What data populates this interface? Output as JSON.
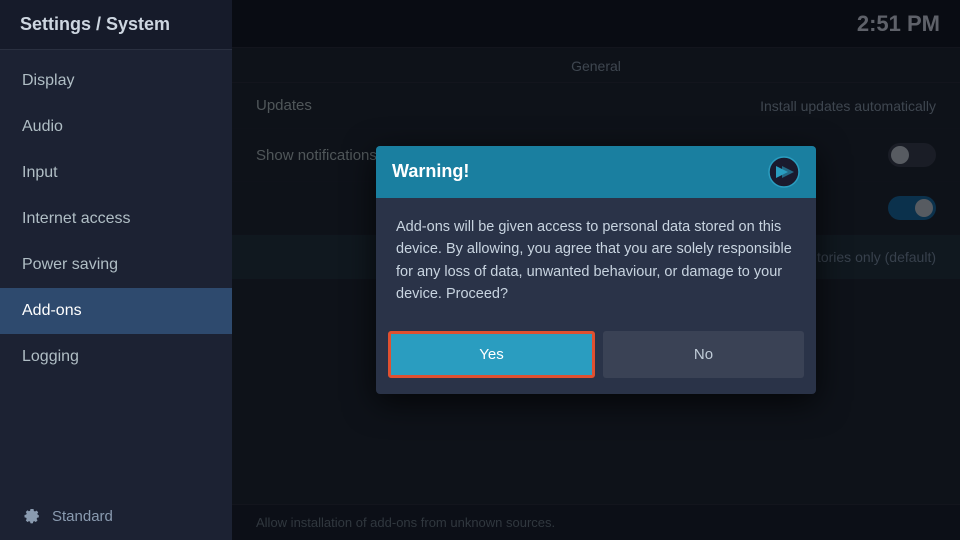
{
  "sidebar": {
    "title": "Settings / System",
    "items": [
      {
        "id": "display",
        "label": "Display",
        "active": false
      },
      {
        "id": "audio",
        "label": "Audio",
        "active": false
      },
      {
        "id": "input",
        "label": "Input",
        "active": false
      },
      {
        "id": "internet-access",
        "label": "Internet access",
        "active": false
      },
      {
        "id": "power-saving",
        "label": "Power saving",
        "active": false
      },
      {
        "id": "add-ons",
        "label": "Add-ons",
        "active": true
      },
      {
        "id": "logging",
        "label": "Logging",
        "active": false
      }
    ],
    "footer_label": "Standard"
  },
  "header": {
    "clock": "2:51 PM"
  },
  "main": {
    "section_label": "General",
    "rows": [
      {
        "label": "Updates",
        "value": "Install updates automatically",
        "type": "text"
      },
      {
        "label": "Show notifications",
        "value": "",
        "type": "toggle_off"
      },
      {
        "label": "",
        "value": "",
        "type": "toggle_on"
      },
      {
        "label": "",
        "value": "Official repositories only (default)",
        "type": "repos"
      }
    ],
    "bottom_hint": "Allow installation of add-ons from unknown sources."
  },
  "dialog": {
    "title": "Warning!",
    "body": "Add-ons will be given access to personal data stored on this device. By allowing, you agree that you are solely responsible for any loss of data, unwanted behaviour, or damage to your device. Proceed?",
    "btn_yes": "Yes",
    "btn_no": "No"
  }
}
